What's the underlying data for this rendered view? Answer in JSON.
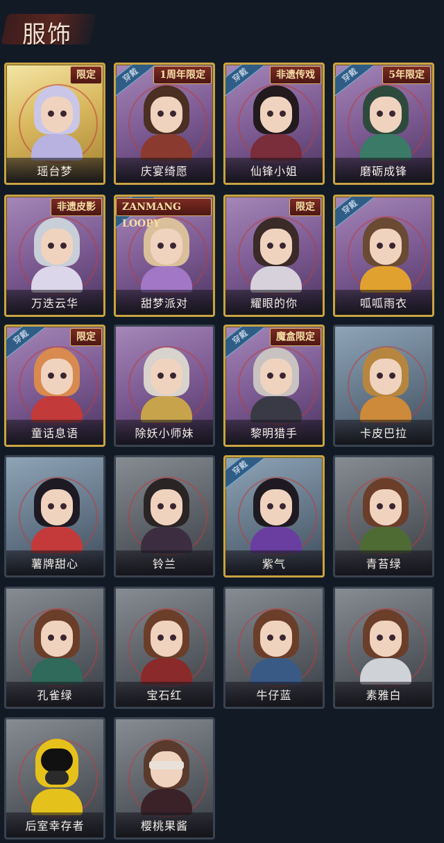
{
  "header": {
    "title": "服饰"
  },
  "tags": {
    "wear": "穿戴"
  },
  "costumes": [
    {
      "name": "瑶台梦",
      "rarity": "gold",
      "frame": "gold",
      "ribbon": "限定",
      "worn": false,
      "hair": "#c9c6e8",
      "outfit": "#b7b2df"
    },
    {
      "name": "庆宴绮愿",
      "rarity": "purple",
      "frame": "gold",
      "ribbon": "1周年限定",
      "worn": true,
      "hair": "#4a2f22",
      "outfit": "#8b3a2f"
    },
    {
      "name": "仙锋小姐",
      "rarity": "purple",
      "frame": "gold",
      "ribbon": "非遗传戏",
      "worn": true,
      "hair": "#221a1d",
      "outfit": "#7a2d3a"
    },
    {
      "name": "磨砺成锋",
      "rarity": "purple",
      "frame": "gold",
      "ribbon": "5年限定",
      "worn": true,
      "hair": "#2e4a3c",
      "outfit": "#3a7a66"
    },
    {
      "name": "万迭云华",
      "rarity": "purple",
      "frame": "gold",
      "ribbon": "非遗皮影",
      "worn": false,
      "hair": "#c8cfd8",
      "outfit": "#dcd6ea"
    },
    {
      "name": "甜梦派对",
      "rarity": "purple",
      "frame": "gold",
      "ribbon": "ZANMANG LOOPY",
      "worn": true,
      "hair": "#d9c09a",
      "outfit": "#a277c6"
    },
    {
      "name": "耀眼的你",
      "rarity": "purple",
      "frame": "gold",
      "ribbon": "限定",
      "worn": false,
      "hair": "#3a2a28",
      "outfit": "#d7d1db"
    },
    {
      "name": "呱呱雨衣",
      "rarity": "purple",
      "frame": "gold",
      "ribbon": "",
      "worn": true,
      "hair": "#6a4a32",
      "outfit": "#e1a12e"
    },
    {
      "name": "童话息语",
      "rarity": "purple",
      "frame": "gold",
      "ribbon": "限定",
      "worn": true,
      "hair": "#d98a4e",
      "outfit": "#c23a3a"
    },
    {
      "name": "除妖小师妹",
      "rarity": "purple",
      "frame": "plain",
      "ribbon": "",
      "worn": false,
      "hair": "#d8d3cc",
      "outfit": "#c7a34c"
    },
    {
      "name": "黎明猎手",
      "rarity": "purple",
      "frame": "gold",
      "ribbon": "魔盒限定",
      "worn": true,
      "hair": "#c8c3c0",
      "outfit": "#3a3a46"
    },
    {
      "name": "卡皮巴拉",
      "rarity": "slate",
      "frame": "plain",
      "ribbon": "",
      "worn": false,
      "hair": "#b7863e",
      "outfit": "#cc8a3a"
    },
    {
      "name": "薯牌甜心",
      "rarity": "slate",
      "frame": "plain",
      "ribbon": "",
      "worn": false,
      "hair": "#1e1a24",
      "outfit": "#c43a3a"
    },
    {
      "name": "铃兰",
      "rarity": "gray",
      "frame": "plain",
      "ribbon": "",
      "worn": false,
      "hair": "#2a2424",
      "outfit": "#3c2e40"
    },
    {
      "name": "紫气",
      "rarity": "slate",
      "frame": "gold",
      "ribbon": "",
      "worn": true,
      "hair": "#1f1a22",
      "outfit": "#6a3ea0"
    },
    {
      "name": "青苔绿",
      "rarity": "gray",
      "frame": "plain",
      "ribbon": "",
      "worn": false,
      "hair": "#6b3e2a",
      "outfit": "#4f6b34"
    },
    {
      "name": "孔雀绿",
      "rarity": "gray",
      "frame": "plain",
      "ribbon": "",
      "worn": false,
      "hair": "#6b3e2a",
      "outfit": "#2f6a5a"
    },
    {
      "name": "宝石红",
      "rarity": "gray",
      "frame": "plain",
      "ribbon": "",
      "worn": false,
      "hair": "#6b3e2a",
      "outfit": "#8a2a2a"
    },
    {
      "name": "牛仔蓝",
      "rarity": "gray",
      "frame": "plain",
      "ribbon": "",
      "worn": false,
      "hair": "#6b3e2a",
      "outfit": "#3a5a86"
    },
    {
      "name": "素雅白",
      "rarity": "gray",
      "frame": "plain",
      "ribbon": "",
      "worn": false,
      "hair": "#6b3e2a",
      "outfit": "#cfd2d6"
    },
    {
      "name": "后室幸存者",
      "rarity": "gray",
      "frame": "plain",
      "ribbon": "",
      "worn": false,
      "hair": "#e5c21b",
      "outfit": "#e5c21b",
      "style": "hazmat"
    },
    {
      "name": "樱桃果酱",
      "rarity": "gray",
      "frame": "plain",
      "ribbon": "",
      "worn": false,
      "hair": "#5a3a2c",
      "outfit": "#3a2228",
      "style": "blindfold"
    }
  ]
}
